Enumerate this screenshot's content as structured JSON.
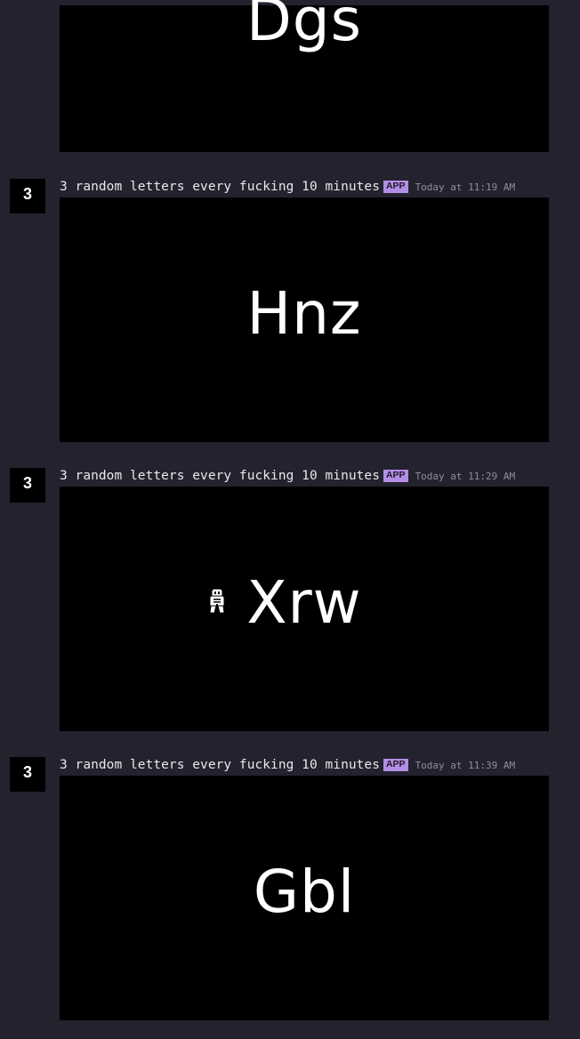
{
  "messages": [
    {
      "image_text": "Dgs"
    },
    {
      "avatar": "3",
      "author": "3 random letters every fucking 10 minutes",
      "badge": "APP",
      "timestamp": "Today at 11:19 AM",
      "image_text": "Hnz"
    },
    {
      "avatar": "3",
      "author": "3 random letters every fucking 10 minutes",
      "badge": "APP",
      "timestamp": "Today at 11:29 AM",
      "image_text": "Xrw"
    },
    {
      "avatar": "3",
      "author": "3 random letters every fucking 10 minutes",
      "badge": "APP",
      "timestamp": "Today at 11:39 AM",
      "image_text": "Gbl"
    }
  ],
  "colors": {
    "background": "#23222e",
    "badge": "#b48ee6",
    "image_bg": "#000000",
    "letters": "#ffffff"
  },
  "icons": {
    "cursor": "custom-mouse-cursor-icon"
  }
}
